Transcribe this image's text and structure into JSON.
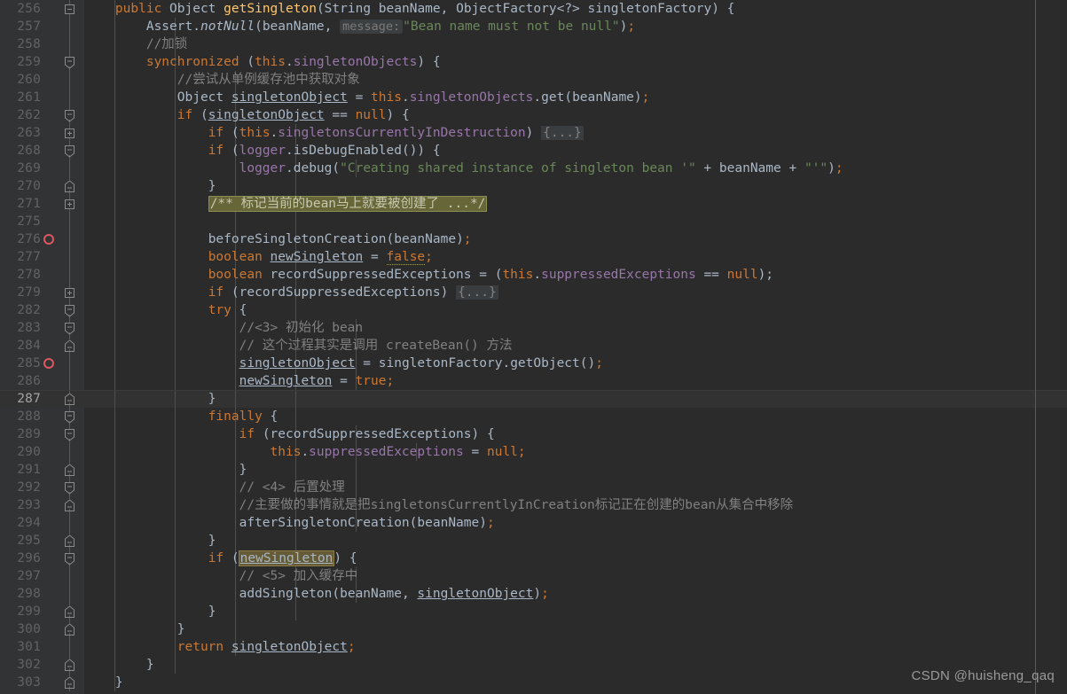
{
  "editor": {
    "theme": "darcula",
    "background": "#2b2b2b",
    "gutter_background": "#313335",
    "current_line_background": "#323232",
    "margin_guide_color": "#585c5e",
    "breakpoint_color": "#db5860",
    "current_line": 287,
    "watermark": "CSDN @huisheng_qaq",
    "colors": {
      "keyword": "#cc7832",
      "string": "#6a8759",
      "comment": "#808080",
      "field": "#9876aa",
      "method_declaration": "#ffc66d",
      "identifier": "#a9b7c6",
      "line_number": "#606366",
      "line_number_active": "#a4a3a3",
      "inlay_hint_bg": "#3c3f41",
      "fold_placeholder_bg": "#3a3d3f",
      "javadoc_fold_bg": "#666638",
      "caret_identifier_highlight": "#655c37"
    }
  },
  "lines": [
    {
      "n": 256,
      "fold": "minus",
      "bp": false,
      "indent": 0
    },
    {
      "n": 257,
      "fold": "none",
      "bp": false,
      "indent": 0
    },
    {
      "n": 258,
      "fold": "none",
      "bp": false,
      "indent": 0
    },
    {
      "n": 259,
      "fold": "minus-top",
      "bp": false,
      "indent": 0
    },
    {
      "n": 260,
      "fold": "none",
      "bp": false,
      "indent": 0
    },
    {
      "n": 261,
      "fold": "none",
      "bp": false,
      "indent": 0
    },
    {
      "n": 262,
      "fold": "minus-top",
      "bp": false,
      "indent": 0
    },
    {
      "n": 263,
      "fold": "plus",
      "bp": false,
      "indent": 0
    },
    {
      "n": 268,
      "fold": "minus-top",
      "bp": false,
      "indent": 0
    },
    {
      "n": 269,
      "fold": "none",
      "bp": false,
      "indent": 0
    },
    {
      "n": 270,
      "fold": "minus-bottom",
      "bp": false,
      "indent": 0
    },
    {
      "n": 271,
      "fold": "plus",
      "bp": false,
      "indent": 0
    },
    {
      "n": 275,
      "fold": "none",
      "bp": false,
      "indent": 0
    },
    {
      "n": 276,
      "fold": "none",
      "bp": true,
      "indent": 0
    },
    {
      "n": 277,
      "fold": "none",
      "bp": false,
      "indent": 0
    },
    {
      "n": 278,
      "fold": "none",
      "bp": false,
      "indent": 0
    },
    {
      "n": 279,
      "fold": "plus",
      "bp": false,
      "indent": 0
    },
    {
      "n": 282,
      "fold": "minus-top",
      "bp": false,
      "indent": 0
    },
    {
      "n": 283,
      "fold": "minus-top",
      "bp": false,
      "indent": 0
    },
    {
      "n": 284,
      "fold": "minus-bottom",
      "bp": false,
      "indent": 0
    },
    {
      "n": 285,
      "fold": "none",
      "bp": true,
      "indent": 0
    },
    {
      "n": 286,
      "fold": "none",
      "bp": false,
      "indent": 0
    },
    {
      "n": 287,
      "fold": "minus-bottom",
      "bp": false,
      "indent": 0,
      "current": true
    },
    {
      "n": 288,
      "fold": "minus-top",
      "bp": false,
      "indent": 0
    },
    {
      "n": 289,
      "fold": "minus-top",
      "bp": false,
      "indent": 0
    },
    {
      "n": 290,
      "fold": "none",
      "bp": false,
      "indent": 0
    },
    {
      "n": 291,
      "fold": "minus-bottom",
      "bp": false,
      "indent": 0
    },
    {
      "n": 292,
      "fold": "minus-top",
      "bp": false,
      "indent": 0
    },
    {
      "n": 293,
      "fold": "minus-bottom",
      "bp": false,
      "indent": 0
    },
    {
      "n": 294,
      "fold": "none",
      "bp": false,
      "indent": 0
    },
    {
      "n": 295,
      "fold": "minus-bottom",
      "bp": false,
      "indent": 0
    },
    {
      "n": 296,
      "fold": "minus-top",
      "bp": false,
      "indent": 0
    },
    {
      "n": 297,
      "fold": "none",
      "bp": false,
      "indent": 0
    },
    {
      "n": 298,
      "fold": "none",
      "bp": false,
      "indent": 0
    },
    {
      "n": 299,
      "fold": "minus-bottom",
      "bp": false,
      "indent": 0
    },
    {
      "n": 300,
      "fold": "minus-bottom",
      "bp": false,
      "indent": 0
    },
    {
      "n": 301,
      "fold": "none",
      "bp": false,
      "indent": 0
    },
    {
      "n": 302,
      "fold": "minus-bottom",
      "bp": false,
      "indent": 0
    },
    {
      "n": 303,
      "fold": "minus-bottom",
      "bp": false,
      "indent": 0
    }
  ],
  "code_text": {
    "l256": "    public Object getSingleton(String beanName, ObjectFactory<?> singletonFactory) {",
    "l257": "        Assert.notNull(beanName, message: \"Bean name must not be null\");",
    "l258": "        //加锁",
    "l259": "        synchronized (this.singletonObjects) {",
    "l260": "            //尝试从单例缓存池中获取对象",
    "l261": "            Object singletonObject = this.singletonObjects.get(beanName);",
    "l262": "            if (singletonObject == null) {",
    "l263": "                if (this.singletonsCurrentlyInDestruction) {...}",
    "l268": "                if (logger.isDebugEnabled()) {",
    "l269": "                    logger.debug(\"Creating shared instance of singleton bean '\" + beanName + \"'\");",
    "l270": "                }",
    "l271": "                /** 标记当前的bean马上就要被创建了 ...*/",
    "l276": "                beforeSingletonCreation(beanName);",
    "l277": "                boolean newSingleton = false;",
    "l278": "                boolean recordSuppressedExceptions = (this.suppressedExceptions == null);",
    "l279": "                if (recordSuppressedExceptions) {...}",
    "l282": "                try {",
    "l283": "                    //<3> 初始化 bean",
    "l284": "                    // 这个过程其实是调用 createBean() 方法",
    "l285": "                    singletonObject = singletonFactory.getObject();",
    "l286": "                    newSingleton = true;",
    "l287": "                }",
    "l288": "                finally {",
    "l289": "                    if (recordSuppressedExceptions) {",
    "l290": "                        this.suppressedExceptions = null;",
    "l291": "                    }",
    "l292": "                    // <4> 后置处理",
    "l293": "                    //主要做的事情就是把singletonsCurrentlyInCreation标记正在创建的bean从集合中移除",
    "l294": "                    afterSingletonCreation(beanName);",
    "l295": "                }",
    "l296": "                if (newSingleton) {",
    "l297": "                    // <5> 加入缓存中",
    "l298": "                    addSingleton(beanName, singletonObject);",
    "l299": "                }",
    "l300": "            }",
    "l301": "            return singletonObject;",
    "l302": "        }",
    "l303": "    }"
  },
  "tokens": {
    "kw_public": "public",
    "kw_synchronized": "synchronized",
    "kw_this": "this",
    "kw_if": "if",
    "kw_null": "null",
    "kw_boolean": "boolean",
    "kw_false": "false",
    "kw_true": "true",
    "kw_try": "try",
    "kw_finally": "finally",
    "kw_return": "return",
    "type_Object": "Object",
    "type_String": "String",
    "type_ObjectFactory": "ObjectFactory<?>",
    "method_name": "getSingleton",
    "param_beanName": "beanName",
    "param_singletonFactory": "singletonFactory",
    "local_singletonObject": "singletonObject",
    "local_newSingleton": "newSingleton",
    "local_recordSuppressedExceptions": "recordSuppressedExceptions",
    "field_singletonObjects": "singletonObjects",
    "field_singletonsCurrentlyInDestruction": "singletonsCurrentlyInDestruction",
    "field_suppressedExceptions": "suppressedExceptions",
    "inlay_hint_message": "message:",
    "string_bean_name_null": "\"Bean name must not be null\"",
    "string_creating": "\"Creating shared instance of singleton bean '\"",
    "string_tail": "\"'\"",
    "fold_placeholder": "{...}",
    "fold_javadoc": "/** 标记当前的bean马上就要被创建了 ...*/",
    "comment_lock": "//加锁",
    "comment_try_get": "//尝试从单例缓存池中获取对象",
    "comment_init_bean": "//<3> 初始化 bean",
    "comment_create_bean": "// 这个过程其实是调用 createBean() 方法",
    "comment_post": "// <4> 后置处理",
    "comment_remove": "//主要做的事情就是把singletonsCurrentlyInCreation标记正在创建的bean从集合中移除",
    "comment_cache": "// <5> 加入缓存中"
  }
}
